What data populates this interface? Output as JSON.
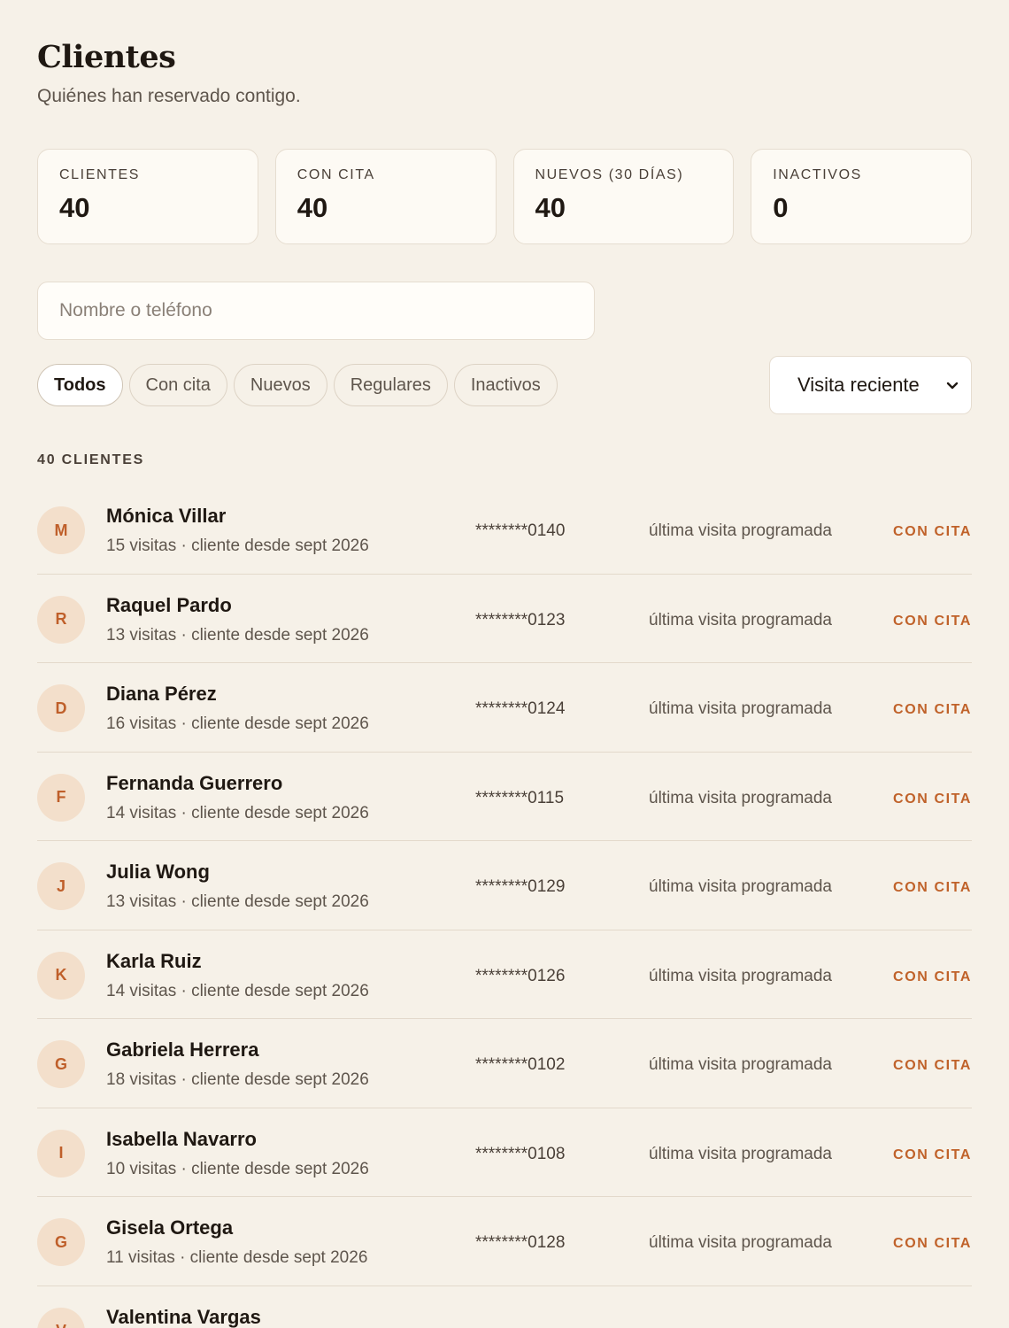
{
  "header": {
    "title": "Clientes",
    "subtitle": "Quiénes han reservado contigo."
  },
  "stats": [
    {
      "label": "CLIENTES",
      "value": "40"
    },
    {
      "label": "CON CITA",
      "value": "40"
    },
    {
      "label": "NUEVOS (30 DÍAS)",
      "value": "40"
    },
    {
      "label": "INACTIVOS",
      "value": "0"
    }
  ],
  "search": {
    "placeholder": "Nombre o teléfono",
    "value": ""
  },
  "filters": [
    {
      "label": "Todos",
      "active": true
    },
    {
      "label": "Con cita",
      "active": false
    },
    {
      "label": "Nuevos",
      "active": false
    },
    {
      "label": "Regulares",
      "active": false
    },
    {
      "label": "Inactivos",
      "active": false
    }
  ],
  "sort": {
    "selected": "Visita reciente"
  },
  "list": {
    "count_label": "40 CLIENTES",
    "clients": [
      {
        "initial": "M",
        "name": "Mónica Villar",
        "meta": "15 visitas · cliente desde sept 2026",
        "phone": "********0140",
        "last_visit": "última visita programada",
        "status": "CON CITA"
      },
      {
        "initial": "R",
        "name": "Raquel Pardo",
        "meta": "13 visitas · cliente desde sept 2026",
        "phone": "********0123",
        "last_visit": "última visita programada",
        "status": "CON CITA"
      },
      {
        "initial": "D",
        "name": "Diana Pérez",
        "meta": "16 visitas · cliente desde sept 2026",
        "phone": "********0124",
        "last_visit": "última visita programada",
        "status": "CON CITA"
      },
      {
        "initial": "F",
        "name": "Fernanda Guerrero",
        "meta": "14 visitas · cliente desde sept 2026",
        "phone": "********0115",
        "last_visit": "última visita programada",
        "status": "CON CITA"
      },
      {
        "initial": "J",
        "name": "Julia Wong",
        "meta": "13 visitas · cliente desde sept 2026",
        "phone": "********0129",
        "last_visit": "última visita programada",
        "status": "CON CITA"
      },
      {
        "initial": "K",
        "name": "Karla Ruiz",
        "meta": "14 visitas · cliente desde sept 2026",
        "phone": "********0126",
        "last_visit": "última visita programada",
        "status": "CON CITA"
      },
      {
        "initial": "G",
        "name": "Gabriela Herrera",
        "meta": "18 visitas · cliente desde sept 2026",
        "phone": "********0102",
        "last_visit": "última visita programada",
        "status": "CON CITA"
      },
      {
        "initial": "I",
        "name": "Isabella Navarro",
        "meta": "10 visitas · cliente desde sept 2026",
        "phone": "********0108",
        "last_visit": "última visita programada",
        "status": "CON CITA"
      },
      {
        "initial": "G",
        "name": "Gisela Ortega",
        "meta": "11 visitas · cliente desde sept 2026",
        "phone": "********0128",
        "last_visit": "última visita programada",
        "status": "CON CITA"
      },
      {
        "initial": "V",
        "name": "Valentina Vargas",
        "meta": "",
        "phone": "",
        "last_visit": "",
        "status": ""
      }
    ]
  },
  "colors": {
    "background": "#f6f1e8",
    "accent": "#c0622a",
    "avatar_bg": "#f3dfcb",
    "card_bg": "#fdfaf4"
  },
  "icons": {
    "sort_toggle": "chevron-down-icon"
  }
}
